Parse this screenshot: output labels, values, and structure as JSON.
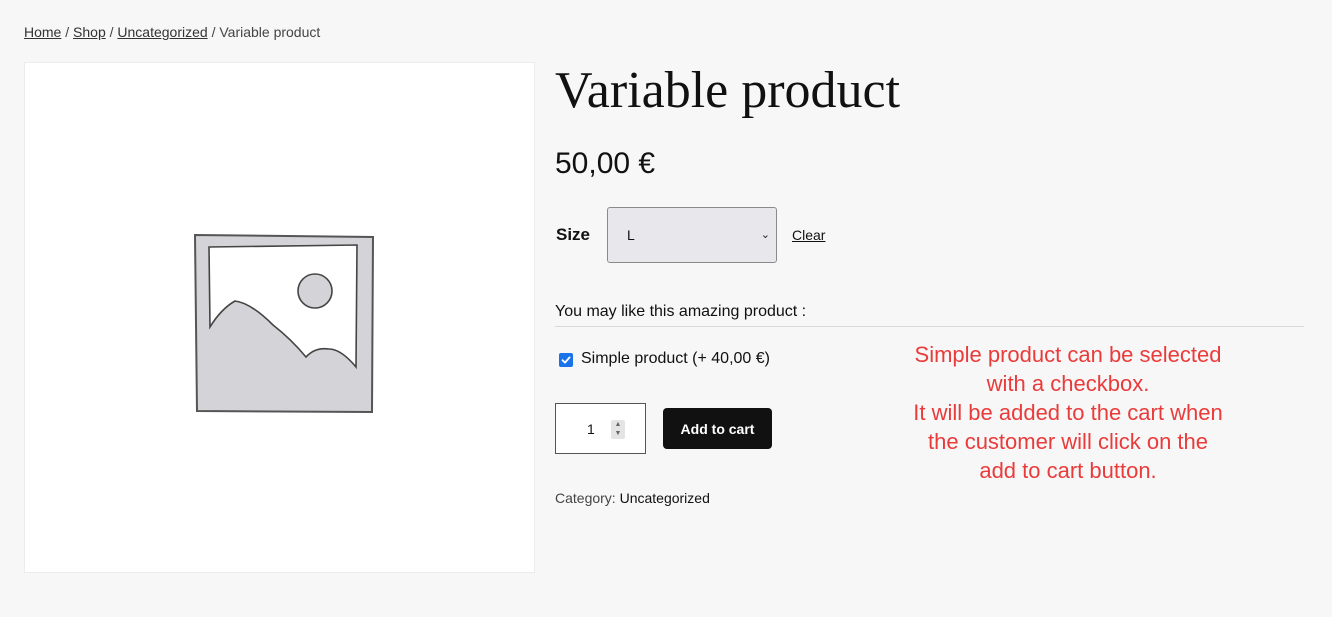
{
  "breadcrumb": {
    "items": [
      "Home",
      "Shop",
      "Uncategorized"
    ],
    "separator": "/",
    "current": "Variable product"
  },
  "product": {
    "title": "Variable product",
    "price": "50,00 €",
    "image_icon": "placeholder-image-icon"
  },
  "variation": {
    "label": "Size",
    "selected": "L",
    "clear_label": "Clear"
  },
  "upsell": {
    "heading": "You may like this amazing product :",
    "item_label": "Simple product (+ 40,00 €)",
    "checked": true
  },
  "cart": {
    "quantity": "1",
    "button_label": "Add to cart"
  },
  "meta": {
    "category_label": "Category:",
    "category_value": "Uncategorized"
  },
  "annotation": {
    "lines": [
      "Simple product can be selected",
      "with a checkbox.",
      "It will be added to the cart when",
      "the customer will click on the",
      "add to cart button."
    ],
    "color": "#ea3b3b"
  },
  "colors": {
    "background": "#f7f7f7",
    "button": "#111111",
    "checkbox": "#1a73e8"
  }
}
